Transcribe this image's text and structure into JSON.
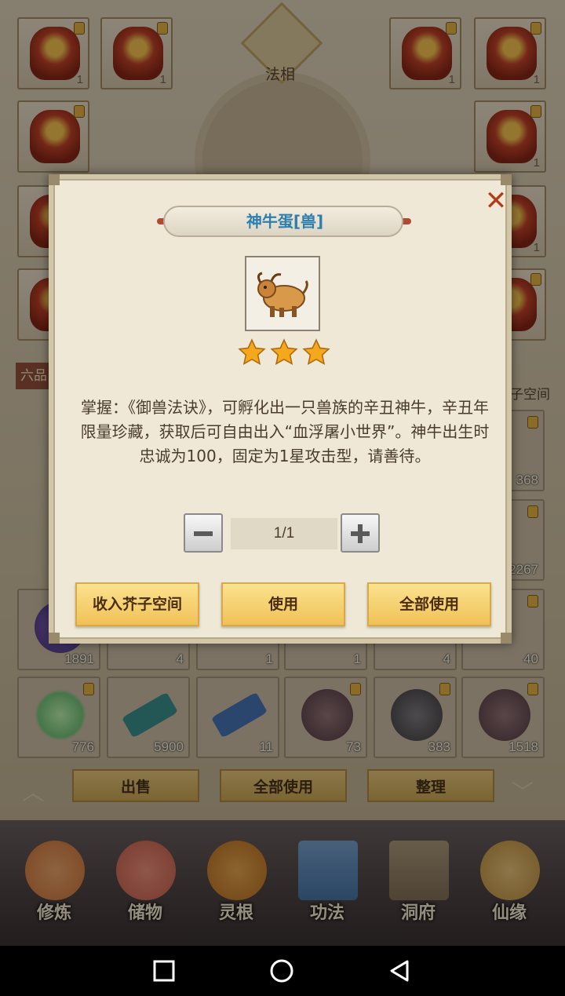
{
  "background": {
    "top_label": "法相",
    "rank_tab": "六品",
    "space_label": "子空间",
    "equip_counts": [
      "1",
      "1",
      "1",
      "1",
      "1",
      "1"
    ],
    "grid_counts": [
      "368",
      "2267",
      "1891",
      "4",
      "1",
      "1",
      "4",
      "40"
    ],
    "grid_bottom": [
      {
        "count": "776",
        "color": "#6bc17a"
      },
      {
        "count": "5900",
        "color": "#2e8c8f"
      },
      {
        "count": "11",
        "color": "#3c6fb5"
      },
      {
        "count": "73",
        "color": "#6a4f5a"
      },
      {
        "count": "383",
        "color": "#4d4d55"
      },
      {
        "count": "1518",
        "color": "#6a4f5a"
      }
    ],
    "actions": {
      "sell": "出售",
      "use_all": "全部使用",
      "sort": "整理"
    },
    "nav": [
      {
        "label": "修炼",
        "color": "#c96e34"
      },
      {
        "label": "储物",
        "color": "#c25a4a"
      },
      {
        "label": "灵根",
        "color": "#b66a1f"
      },
      {
        "label": "功法",
        "color": "#3d6fa6"
      },
      {
        "label": "洞府",
        "color": "#7a6b56"
      },
      {
        "label": "仙缘",
        "color": "#b88a3a"
      }
    ]
  },
  "modal": {
    "title": "神牛蛋[兽]",
    "close_icon": "close-icon",
    "item_icon": "ox-icon",
    "stars": 3,
    "description": "掌握：《御兽法诀》，可孵化出一只兽族的辛丑神牛，辛丑年限量珍藏，获取后可自由出入“血浮屠小世界”。神牛出生时忠诚为100，固定为1星攻击型，请善待。",
    "quantity": "1/1",
    "buttons": {
      "store": "收入芥子空间",
      "use": "使用",
      "use_all": "全部使用"
    }
  },
  "colors": {
    "accent": "#f0c257",
    "title": "#2e7fb0",
    "close": "#b33a1a",
    "star": "#f5a81c"
  }
}
